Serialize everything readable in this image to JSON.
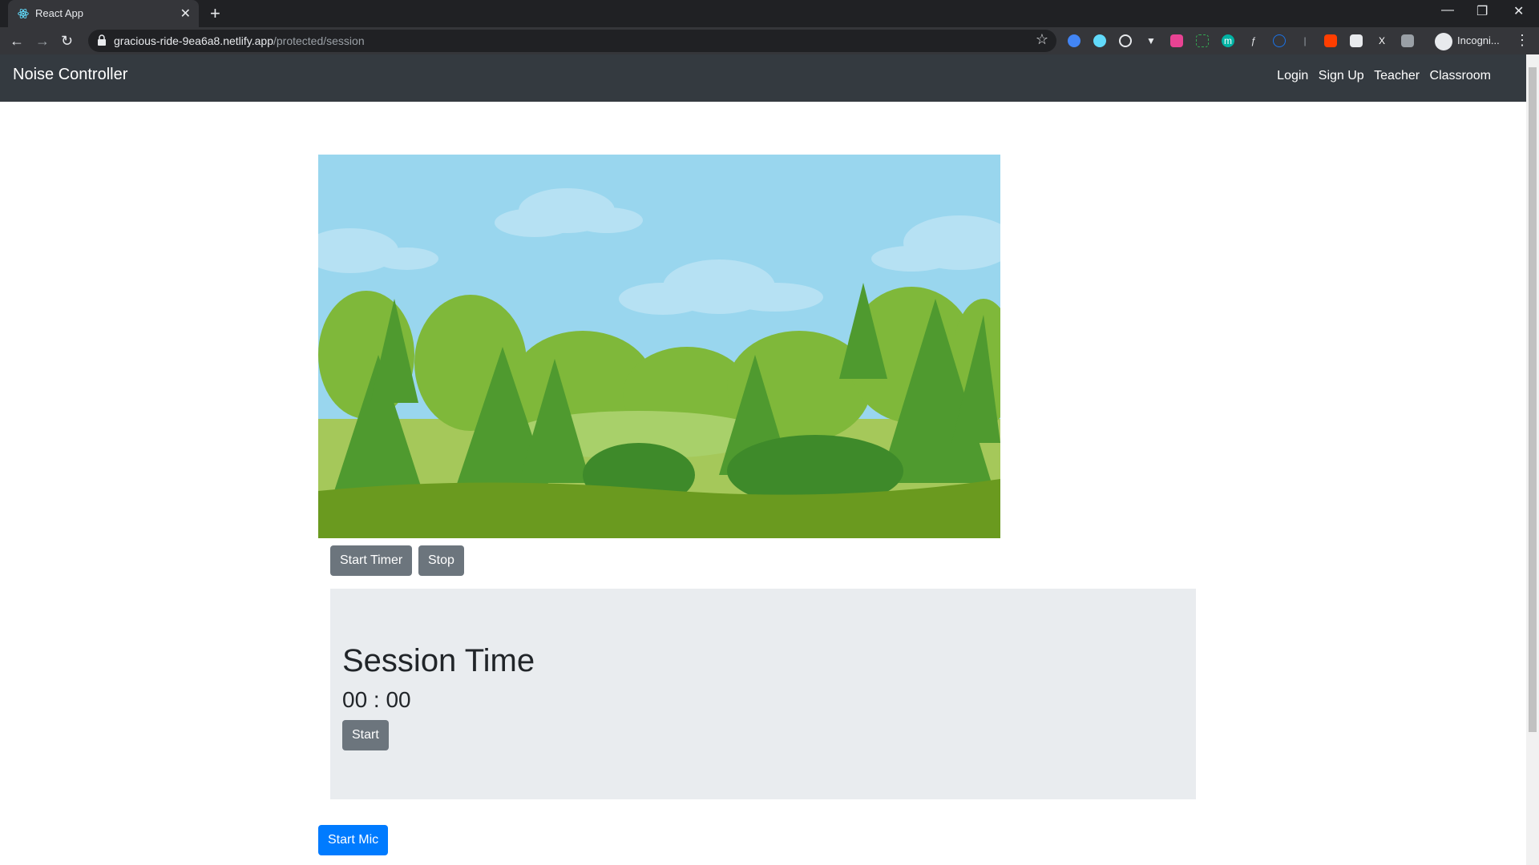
{
  "browser": {
    "tab_title": "React App",
    "url_host": "gracious-ride-9ea6a8.netlify.app",
    "url_path": "/protected/session",
    "profile_label": "Incogni..."
  },
  "navbar": {
    "brand": "Noise Controller",
    "links": [
      "Login",
      "Sign Up",
      "Teacher",
      "Classroom"
    ]
  },
  "controls": {
    "start_timer": "Start Timer",
    "stop": "Stop"
  },
  "session": {
    "title": "Session Time",
    "time": "00 : 00",
    "start": "Start"
  },
  "mic": {
    "start_mic": "Start Mic"
  },
  "colors": {
    "navbar_bg": "#343a40",
    "btn_secondary": "#6c757d",
    "btn_primary": "#007bff",
    "jumbotron_bg": "#e9ecef"
  }
}
